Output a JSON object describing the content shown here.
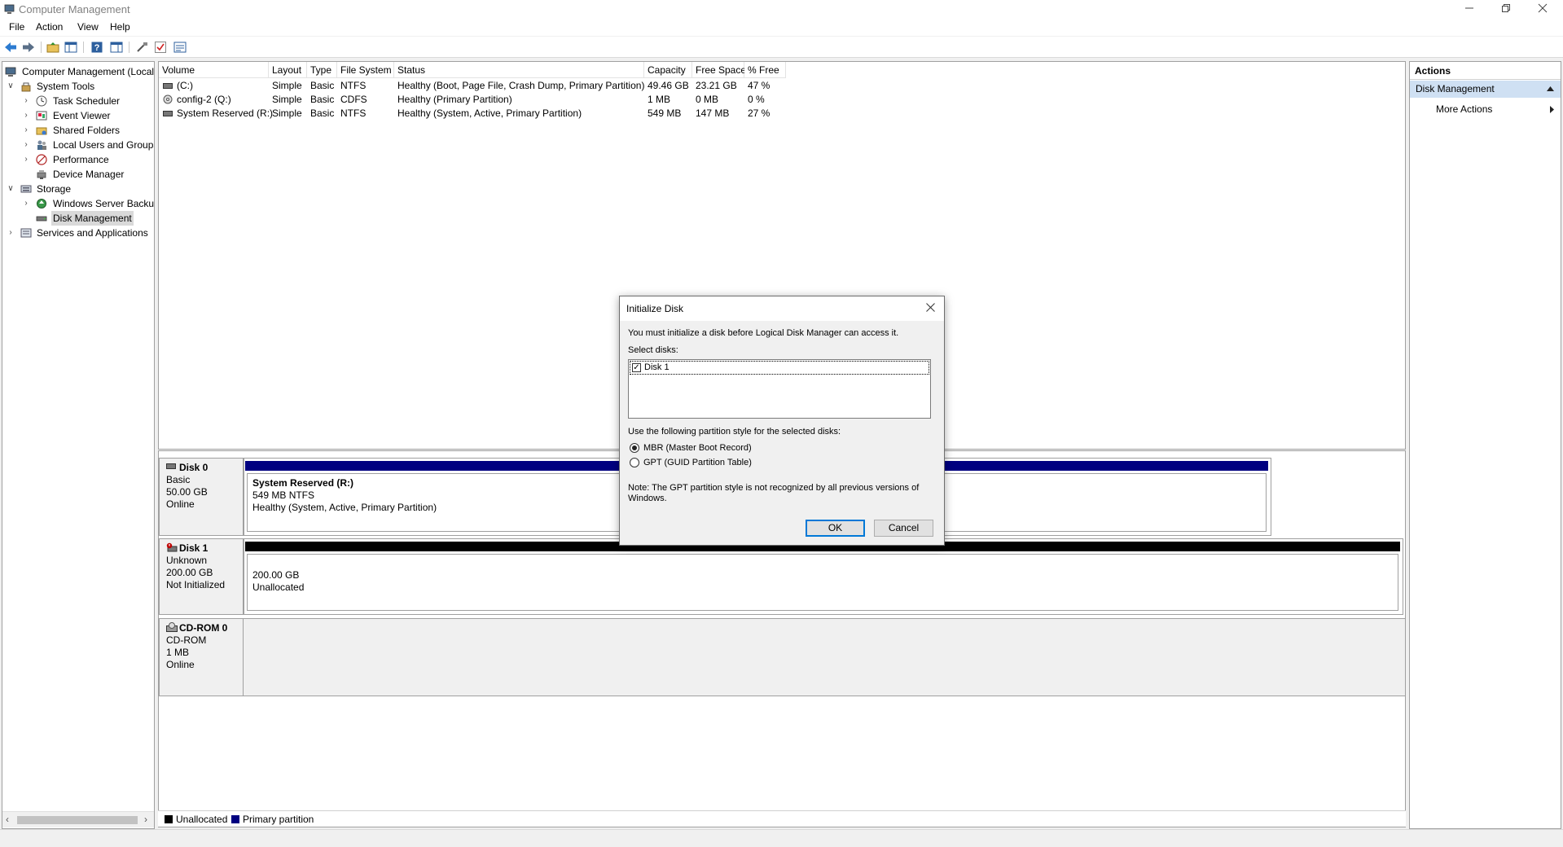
{
  "window": {
    "title": "Computer Management"
  },
  "menu": [
    "File",
    "Action",
    "View",
    "Help"
  ],
  "tree": {
    "root": "Computer Management (Local",
    "system_tools": "System Tools",
    "task_scheduler": "Task Scheduler",
    "event_viewer": "Event Viewer",
    "shared_folders": "Shared Folders",
    "local_users": "Local Users and Groups",
    "performance": "Performance",
    "device_manager": "Device Manager",
    "storage": "Storage",
    "windows_server_backup": "Windows Server Backup",
    "disk_management": "Disk Management",
    "services": "Services and Applications"
  },
  "volume_table": {
    "columns": [
      "Volume",
      "Layout",
      "Type",
      "File System",
      "Status",
      "Capacity",
      "Free Space",
      "% Free"
    ],
    "rows": [
      [
        "(C:)",
        "Simple",
        "Basic",
        "NTFS",
        "Healthy (Boot, Page File, Crash Dump, Primary Partition)",
        "49.46 GB",
        "23.21 GB",
        "47 %"
      ],
      [
        "config-2 (Q:)",
        "Simple",
        "Basic",
        "CDFS",
        "Healthy (Primary Partition)",
        "1 MB",
        "0 MB",
        "0 %"
      ],
      [
        "System Reserved (R:)",
        "Simple",
        "Basic",
        "NTFS",
        "Healthy (System, Active, Primary Partition)",
        "549 MB",
        "147 MB",
        "27 %"
      ]
    ]
  },
  "disks": {
    "disk0": {
      "name": "Disk 0",
      "type": "Basic",
      "size": "50.00 GB",
      "state": "Online",
      "volume": {
        "name": "System Reserved  (R:)",
        "size": "549 MB NTFS",
        "status": "Healthy (System, Active, Primary Partition)"
      }
    },
    "disk1": {
      "name": "Disk 1",
      "type": "Unknown",
      "size": "200.00 GB",
      "state": "Not Initialized",
      "volume": {
        "size": "200.00 GB",
        "status": "Unallocated"
      }
    },
    "cdrom0": {
      "name": "CD-ROM 0",
      "type": "CD-ROM",
      "size": "1 MB",
      "state": "Online"
    }
  },
  "legend": {
    "unallocated": "Unallocated",
    "primary": "Primary partition"
  },
  "actions": {
    "title": "Actions",
    "section": "Disk Management",
    "more": "More Actions"
  },
  "dialog": {
    "title": "Initialize Disk",
    "intro": "You must initialize a disk before Logical Disk Manager can access it.",
    "select_label": "Select disks:",
    "disk_item": "Disk 1",
    "partition_label": "Use the following partition style for the selected disks:",
    "mbr": "MBR (Master Boot Record)",
    "gpt": "GPT (GUID Partition Table)",
    "note": "Note: The GPT partition style is not recognized by all previous versions of Windows.",
    "ok": "OK",
    "cancel": "Cancel"
  },
  "colors": {
    "primary_partition": "#000080",
    "unallocated": "#000000",
    "selection": "#cfe0f3",
    "dialog_default_border": "#0078d7"
  }
}
